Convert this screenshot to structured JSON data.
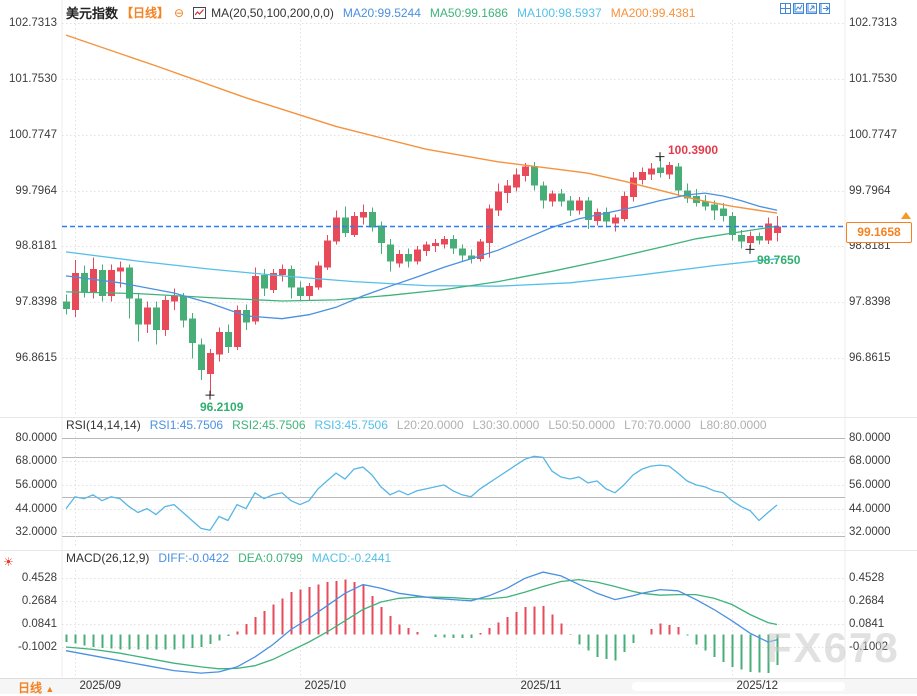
{
  "colors": {
    "up": "#e84a5a",
    "down": "#47ae77",
    "ma20": "#4a90e2",
    "ma50": "#3eb37a",
    "ma100": "#54c0e8",
    "ma200": "#f5923e",
    "rsi_line": "#56b7e6",
    "price_line": "#2d7ff0",
    "accent_orange": "#f58220",
    "high_label": "#e23b4e",
    "low_label": "#2faf6e",
    "gray_label": "#b0b0b0",
    "dark_text": "#333333",
    "sun_red": "#e8392f"
  },
  "icons": {
    "collapse": "⊖",
    "caret_up": "▲",
    "sun": "☀"
  },
  "header": {
    "symbol": "美元指数",
    "period_tag": "【日线】",
    "ma_title": "MA(20,50,100,200,0,0)",
    "ma20": "MA20:99.5244",
    "ma50": "MA50:99.1686",
    "ma100": "MA100:98.5937",
    "ma200": "MA200:99.4381"
  },
  "rsi_header": {
    "title": "RSI(14,14,14)",
    "rsi1": "RSI1:45.7506",
    "rsi2": "RSI2:45.7506",
    "rsi3": "RSI3:45.7506",
    "l20": "L20:20.0000",
    "l30": "L30:30.0000",
    "l50": "L50:50.0000",
    "l70": "L70:70.0000",
    "l80": "L80:80.0000"
  },
  "macd_header": {
    "title": "MACD(26,12,9)",
    "diff": "DIFF:-0.0422",
    "dea": "DEA:0.0799",
    "macd": "MACD:-0.2441"
  },
  "annotations": {
    "high": "100.3900",
    "low": "96.2109",
    "recent_low": "98.7650",
    "current_price": "99.1658"
  },
  "bottom_bar": {
    "period": "日线"
  },
  "watermark": "FX678",
  "chart_data": {
    "main": {
      "type": "candlestick",
      "title": "美元指数 日线",
      "ticks": [
        "102.7313",
        "101.7530",
        "100.7747",
        "99.7964",
        "98.8181",
        "97.8398",
        "96.8615"
      ],
      "months": [
        {
          "i": 1,
          "label": "2025/09"
        },
        {
          "i": 26,
          "label": "2025/10"
        },
        {
          "i": 50,
          "label": "2025/11"
        },
        {
          "i": 74,
          "label": "2025/12"
        }
      ],
      "current_price": 99.1658,
      "high": {
        "i": 66,
        "price": 100.39
      },
      "low": {
        "i": 16,
        "price": 96.2109
      },
      "recent_low": {
        "i": 76,
        "price": 98.765
      },
      "candles": [
        [
          97.85,
          97.97,
          97.62,
          97.72
        ],
        [
          97.7,
          98.58,
          97.58,
          98.35
        ],
        [
          98.35,
          98.48,
          97.92,
          98.02
        ],
        [
          98.0,
          98.62,
          97.9,
          98.42
        ],
        [
          98.4,
          98.5,
          97.85,
          97.95
        ],
        [
          97.95,
          98.5,
          97.85,
          98.4
        ],
        [
          98.38,
          98.55,
          98.1,
          98.45
        ],
        [
          98.45,
          98.5,
          97.55,
          97.9
        ],
        [
          97.9,
          98.0,
          97.15,
          97.45
        ],
        [
          97.45,
          97.85,
          97.3,
          97.75
        ],
        [
          97.75,
          97.85,
          97.1,
          97.35
        ],
        [
          97.35,
          97.95,
          97.25,
          97.88
        ],
        [
          97.85,
          98.08,
          97.7,
          97.95
        ],
        [
          97.95,
          98.0,
          97.4,
          97.52
        ],
        [
          97.55,
          97.65,
          96.85,
          97.12
        ],
        [
          97.1,
          97.2,
          96.48,
          96.65
        ],
        [
          96.58,
          97.02,
          96.2109,
          96.95
        ],
        [
          96.92,
          97.4,
          96.8,
          97.32
        ],
        [
          97.32,
          97.45,
          96.95,
          97.05
        ],
        [
          97.05,
          97.78,
          97.0,
          97.7
        ],
        [
          97.7,
          97.8,
          97.35,
          97.48
        ],
        [
          97.5,
          98.45,
          97.45,
          98.3
        ],
        [
          98.32,
          98.42,
          97.95,
          98.08
        ],
        [
          98.05,
          98.42,
          98.0,
          98.35
        ],
        [
          98.32,
          98.5,
          98.2,
          98.42
        ],
        [
          98.42,
          98.48,
          97.9,
          98.1
        ],
        [
          98.1,
          98.2,
          97.85,
          97.95
        ],
        [
          97.95,
          98.18,
          97.88,
          98.12
        ],
        [
          98.1,
          98.55,
          98.05,
          98.48
        ],
        [
          98.45,
          99.02,
          98.4,
          98.92
        ],
        [
          98.9,
          99.45,
          98.85,
          99.32
        ],
        [
          99.32,
          99.52,
          98.98,
          99.05
        ],
        [
          99.02,
          99.42,
          98.98,
          99.35
        ],
        [
          99.32,
          99.55,
          99.2,
          99.42
        ],
        [
          99.42,
          99.5,
          99.08,
          99.15
        ],
        [
          99.18,
          99.25,
          98.68,
          98.88
        ],
        [
          98.85,
          98.95,
          98.38,
          98.55
        ],
        [
          98.52,
          98.75,
          98.45,
          98.68
        ],
        [
          98.68,
          98.78,
          98.45,
          98.55
        ],
        [
          98.55,
          98.82,
          98.5,
          98.76
        ],
        [
          98.74,
          98.9,
          98.65,
          98.85
        ],
        [
          98.82,
          98.95,
          98.72,
          98.88
        ],
        [
          98.85,
          99.0,
          98.78,
          98.95
        ],
        [
          98.95,
          99.02,
          98.68,
          98.78
        ],
        [
          98.78,
          98.85,
          98.55,
          98.66
        ],
        [
          98.66,
          98.76,
          98.52,
          98.6
        ],
        [
          98.6,
          98.95,
          98.55,
          98.9
        ],
        [
          98.88,
          99.55,
          98.62,
          99.48
        ],
        [
          99.45,
          99.92,
          99.35,
          99.78
        ],
        [
          99.75,
          99.98,
          99.58,
          99.88
        ],
        [
          99.85,
          100.18,
          99.78,
          100.08
        ],
        [
          100.05,
          100.28,
          99.95,
          100.22
        ],
        [
          100.22,
          100.3,
          99.8,
          99.88
        ],
        [
          99.88,
          99.95,
          99.48,
          99.62
        ],
        [
          99.6,
          99.8,
          99.52,
          99.74
        ],
        [
          99.74,
          99.82,
          99.52,
          99.6
        ],
        [
          99.62,
          99.7,
          99.35,
          99.45
        ],
        [
          99.45,
          99.68,
          99.38,
          99.62
        ],
        [
          99.62,
          99.68,
          99.12,
          99.28
        ],
        [
          99.26,
          99.48,
          99.18,
          99.42
        ],
        [
          99.42,
          99.5,
          99.15,
          99.25
        ],
        [
          99.22,
          99.38,
          99.08,
          99.32
        ],
        [
          99.3,
          99.78,
          99.25,
          99.7
        ],
        [
          99.68,
          100.12,
          99.6,
          100.02
        ],
        [
          99.98,
          100.2,
          99.9,
          100.12
        ],
        [
          100.08,
          100.28,
          99.98,
          100.18
        ],
        [
          100.2,
          100.39,
          100.02,
          100.1
        ],
        [
          100.08,
          100.3,
          100.0,
          100.24
        ],
        [
          100.22,
          100.28,
          99.68,
          99.8
        ],
        [
          99.8,
          99.92,
          99.58,
          99.66
        ],
        [
          99.7,
          99.82,
          99.52,
          99.58
        ],
        [
          99.6,
          99.72,
          99.45,
          99.52
        ],
        [
          99.55,
          99.62,
          99.28,
          99.45
        ],
        [
          99.48,
          99.58,
          99.25,
          99.35
        ],
        [
          99.35,
          99.42,
          98.92,
          99.02
        ],
        [
          99.02,
          99.1,
          98.78,
          98.9
        ],
        [
          98.88,
          99.08,
          98.765,
          99.0
        ],
        [
          99.0,
          99.06,
          98.85,
          98.92
        ],
        [
          98.92,
          99.32,
          98.86,
          99.22
        ],
        [
          99.05,
          99.35,
          98.9,
          99.1658
        ]
      ],
      "ma20": [
        [
          0,
          98.3
        ],
        [
          6,
          98.18
        ],
        [
          12,
          98.0
        ],
        [
          16,
          97.82
        ],
        [
          20,
          97.6
        ],
        [
          24,
          97.55
        ],
        [
          27,
          97.62
        ],
        [
          30,
          97.75
        ],
        [
          33,
          97.95
        ],
        [
          36,
          98.12
        ],
        [
          39,
          98.28
        ],
        [
          42,
          98.45
        ],
        [
          45,
          98.6
        ],
        [
          48,
          98.75
        ],
        [
          51,
          98.95
        ],
        [
          54,
          99.15
        ],
        [
          57,
          99.3
        ],
        [
          60,
          99.4
        ],
        [
          63,
          99.5
        ],
        [
          66,
          99.62
        ],
        [
          69,
          99.72
        ],
        [
          71,
          99.75
        ],
        [
          73,
          99.7
        ],
        [
          75,
          99.62
        ],
        [
          77,
          99.52
        ],
        [
          79,
          99.45
        ]
      ],
      "ma50": [
        [
          0,
          98.02
        ],
        [
          8,
          97.99
        ],
        [
          16,
          97.92
        ],
        [
          24,
          97.86
        ],
        [
          30,
          97.88
        ],
        [
          36,
          97.96
        ],
        [
          42,
          98.06
        ],
        [
          48,
          98.2
        ],
        [
          54,
          98.38
        ],
        [
          60,
          98.58
        ],
        [
          66,
          98.8
        ],
        [
          70,
          98.95
        ],
        [
          74,
          99.05
        ],
        [
          79,
          99.17
        ]
      ],
      "ma100": [
        [
          0,
          98.72
        ],
        [
          8,
          98.56
        ],
        [
          16,
          98.42
        ],
        [
          24,
          98.3
        ],
        [
          32,
          98.2
        ],
        [
          40,
          98.13
        ],
        [
          48,
          98.12
        ],
        [
          56,
          98.18
        ],
        [
          64,
          98.32
        ],
        [
          72,
          98.48
        ],
        [
          79,
          98.6
        ]
      ],
      "ma200": [
        [
          0,
          102.52
        ],
        [
          10,
          101.98
        ],
        [
          20,
          101.42
        ],
        [
          30,
          100.92
        ],
        [
          40,
          100.52
        ],
        [
          48,
          100.3
        ],
        [
          54,
          100.18
        ],
        [
          58,
          100.1
        ],
        [
          62,
          99.96
        ],
        [
          66,
          99.8
        ],
        [
          70,
          99.64
        ],
        [
          74,
          99.52
        ],
        [
          79,
          99.4
        ]
      ]
    },
    "rsi": {
      "type": "line",
      "ticks": [
        "80.0000",
        "68.0000",
        "56.0000",
        "44.0000",
        "32.0000"
      ],
      "levels": [
        80,
        70,
        50,
        30
      ],
      "values": [
        44,
        50,
        49,
        51,
        48,
        50,
        49,
        45,
        42,
        44,
        41,
        45,
        46,
        42,
        38,
        34,
        33,
        40,
        38,
        46,
        44,
        52,
        49,
        51,
        52,
        48,
        46,
        48,
        54,
        58,
        62,
        59,
        64,
        65,
        61,
        55,
        51,
        53,
        51,
        53,
        54,
        55,
        56,
        53,
        51,
        50,
        54,
        57,
        60,
        63,
        66,
        69,
        70.5,
        70,
        63,
        60,
        59,
        60,
        57,
        58,
        54,
        52,
        56,
        61,
        64,
        65.5,
        66,
        65.5,
        62,
        58,
        56,
        55,
        53,
        52,
        48,
        45,
        43,
        38,
        42,
        45.8
      ]
    },
    "macd": {
      "type": "macd",
      "ticks": [
        "0.4528",
        "0.2684",
        "0.0841",
        "-0.1002"
      ],
      "diff": [
        [
          0,
          -0.13
        ],
        [
          3,
          -0.17
        ],
        [
          6,
          -0.21
        ],
        [
          9,
          -0.25
        ],
        [
          12,
          -0.29
        ],
        [
          15,
          -0.31
        ],
        [
          17,
          -0.3
        ],
        [
          19,
          -0.26
        ],
        [
          21,
          -0.18
        ],
        [
          23,
          -0.08
        ],
        [
          25,
          0.04
        ],
        [
          27,
          0.13
        ],
        [
          29,
          0.23
        ],
        [
          31,
          0.33
        ],
        [
          33,
          0.4
        ],
        [
          35,
          0.37
        ],
        [
          37,
          0.33
        ],
        [
          39,
          0.31
        ],
        [
          41,
          0.29
        ],
        [
          43,
          0.28
        ],
        [
          45,
          0.27
        ],
        [
          47,
          0.31
        ],
        [
          49,
          0.37
        ],
        [
          51,
          0.45
        ],
        [
          53,
          0.5
        ],
        [
          55,
          0.47
        ],
        [
          57,
          0.4
        ],
        [
          59,
          0.33
        ],
        [
          61,
          0.28
        ],
        [
          63,
          0.31
        ],
        [
          64,
          0.33
        ],
        [
          66,
          0.36
        ],
        [
          68,
          0.35
        ],
        [
          70,
          0.28
        ],
        [
          72,
          0.2
        ],
        [
          74,
          0.11
        ],
        [
          76,
          0.01
        ],
        [
          78,
          -0.06
        ],
        [
          79,
          -0.0422
        ]
      ],
      "dea": [
        [
          0,
          -0.1
        ],
        [
          3,
          -0.12
        ],
        [
          6,
          -0.15
        ],
        [
          9,
          -0.19
        ],
        [
          12,
          -0.23
        ],
        [
          15,
          -0.26
        ],
        [
          17,
          -0.275
        ],
        [
          19,
          -0.272
        ],
        [
          21,
          -0.25
        ],
        [
          23,
          -0.2
        ],
        [
          25,
          -0.13
        ],
        [
          27,
          -0.06
        ],
        [
          29,
          0.02
        ],
        [
          31,
          0.11
        ],
        [
          33,
          0.2
        ],
        [
          35,
          0.26
        ],
        [
          37,
          0.29
        ],
        [
          39,
          0.3
        ],
        [
          41,
          0.3
        ],
        [
          43,
          0.295
        ],
        [
          45,
          0.285
        ],
        [
          47,
          0.285
        ],
        [
          49,
          0.3
        ],
        [
          51,
          0.34
        ],
        [
          53,
          0.385
        ],
        [
          55,
          0.425
        ],
        [
          57,
          0.44
        ],
        [
          59,
          0.42
        ],
        [
          61,
          0.385
        ],
        [
          63,
          0.345
        ],
        [
          64,
          0.33
        ],
        [
          66,
          0.315
        ],
        [
          68,
          0.32
        ],
        [
          70,
          0.32
        ],
        [
          72,
          0.29
        ],
        [
          74,
          0.24
        ],
        [
          76,
          0.16
        ],
        [
          78,
          0.095
        ],
        [
          79,
          0.0799
        ]
      ]
    }
  }
}
